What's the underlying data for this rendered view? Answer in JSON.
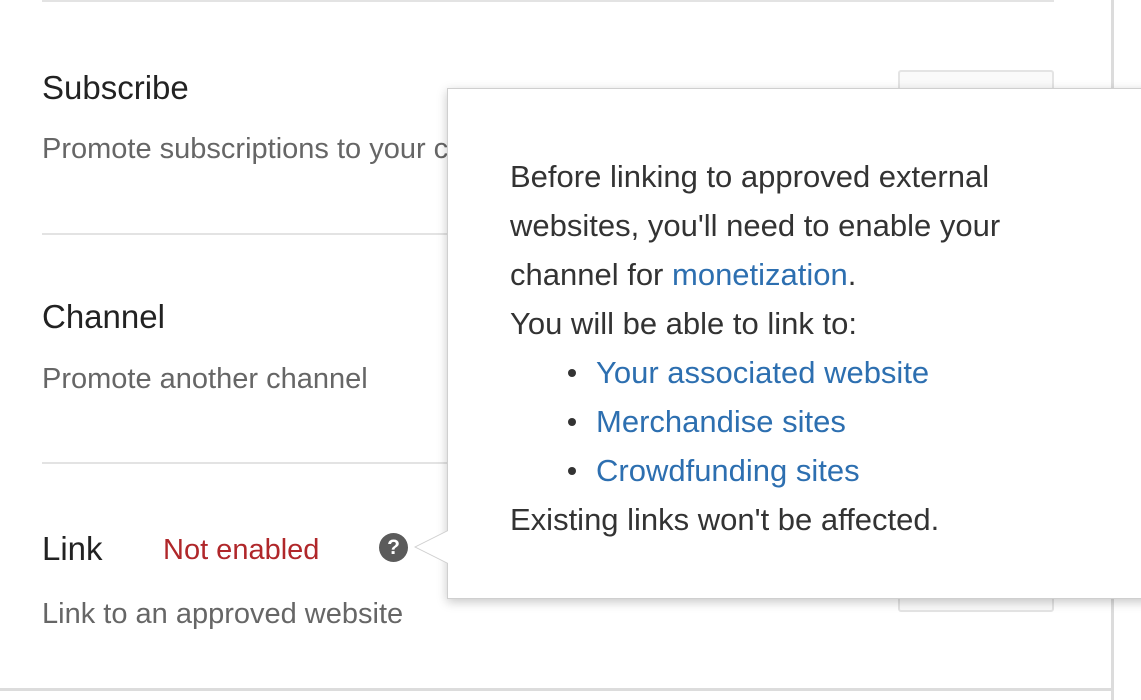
{
  "rows": [
    {
      "title": "Subscribe",
      "description": "Promote subscriptions to your channel"
    },
    {
      "title": "Channel",
      "description": "Promote another channel"
    },
    {
      "title": "Link",
      "status": "Not enabled",
      "help_icon": "question-circle-icon",
      "description": "Link to an approved website"
    }
  ],
  "popover": {
    "line1": "Before linking to approved external",
    "line2": "websites, you'll need to enable your",
    "line3_prefix": "channel for ",
    "line3_link": "monetization",
    "line3_suffix": ".",
    "intro": "You will be able to link to:",
    "items": [
      "Your associated website",
      "Merchandise sites",
      "Crowdfunding sites"
    ],
    "footer": "Existing links won't be affected."
  },
  "colors": {
    "link": "#2d6fb0",
    "status_error": "#b0272a",
    "text_primary": "#222222",
    "text_secondary": "#666666"
  }
}
